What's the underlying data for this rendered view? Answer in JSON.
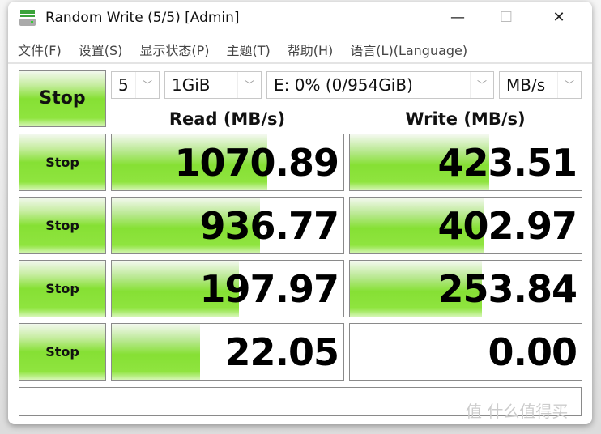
{
  "window": {
    "title": "Random Write (5/5) [Admin]",
    "minimize": "—",
    "maximize": "☐",
    "close": "✕"
  },
  "menu": [
    "文件(F)",
    "设置(S)",
    "显示状态(P)",
    "主题(T)",
    "帮助(H)",
    "语言(L)(Language)"
  ],
  "controls": {
    "main_button": "Stop",
    "count": "5",
    "size": "1GiB",
    "drive": "E: 0% (0/954GiB)",
    "unit": "MB/s"
  },
  "headers": {
    "read": "Read (MB/s)",
    "write": "Write (MB/s)"
  },
  "rows": [
    {
      "button": "Stop",
      "read": "1070.89",
      "write": "423.51",
      "read_fill": 0.67,
      "write_fill": 0.6
    },
    {
      "button": "Stop",
      "read": "936.77",
      "write": "402.97",
      "read_fill": 0.64,
      "write_fill": 0.58
    },
    {
      "button": "Stop",
      "read": "197.97",
      "write": "253.84",
      "read_fill": 0.55,
      "write_fill": 0.57
    },
    {
      "button": "Stop",
      "read": "22.05",
      "write": "0.00",
      "read_fill": 0.38,
      "write_fill": 0
    }
  ],
  "comment": "",
  "watermark": "值 什么值得买",
  "colors": {
    "accent_green": "#86e034"
  }
}
